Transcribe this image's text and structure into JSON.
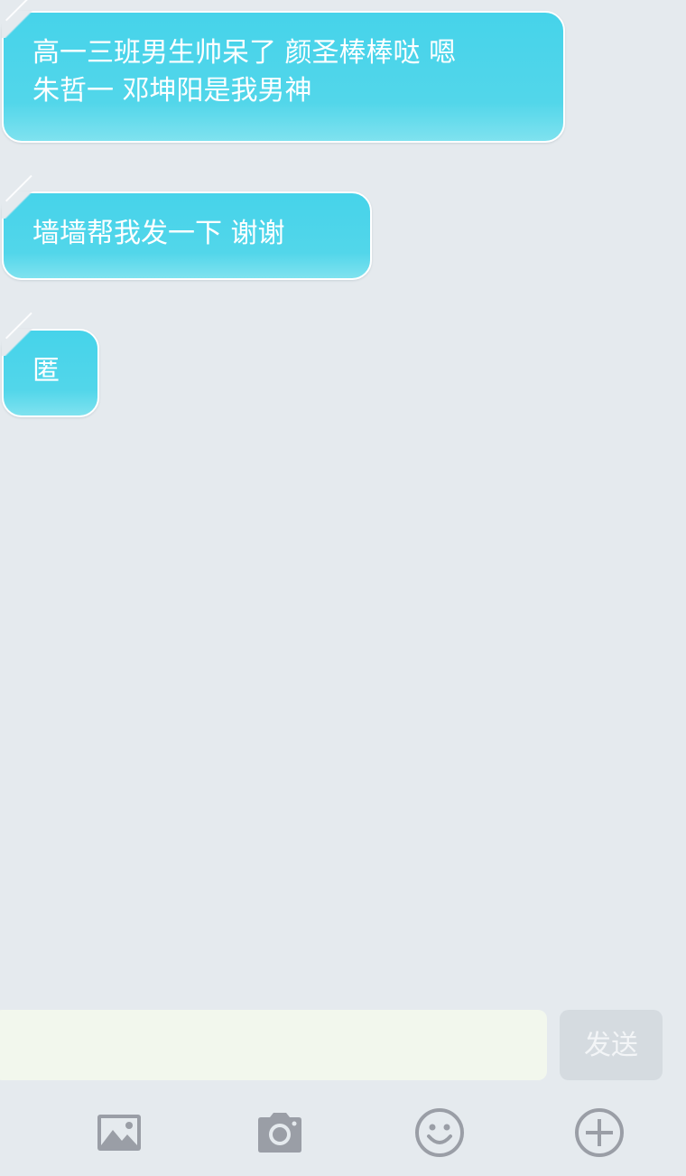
{
  "messages": [
    {
      "text": "高一三班男生帅呆了 颜圣棒棒哒 嗯\n朱哲一 邓坤阳是我男神"
    },
    {
      "text": "墙墙帮我发一下 谢谢"
    },
    {
      "text": "匿"
    }
  ],
  "composer": {
    "input_value": "",
    "input_placeholder": "",
    "send_label": "发送"
  },
  "toolbar": {
    "icons": [
      "image-icon",
      "camera-icon",
      "emoji-icon",
      "plus-circle-icon"
    ]
  },
  "colors": {
    "background": "#e5eaee",
    "bubble": "#4fd5ea",
    "input": "#f2f7ed",
    "send_disabled": "#d5dbe0",
    "icon": "#9a9ea6"
  }
}
